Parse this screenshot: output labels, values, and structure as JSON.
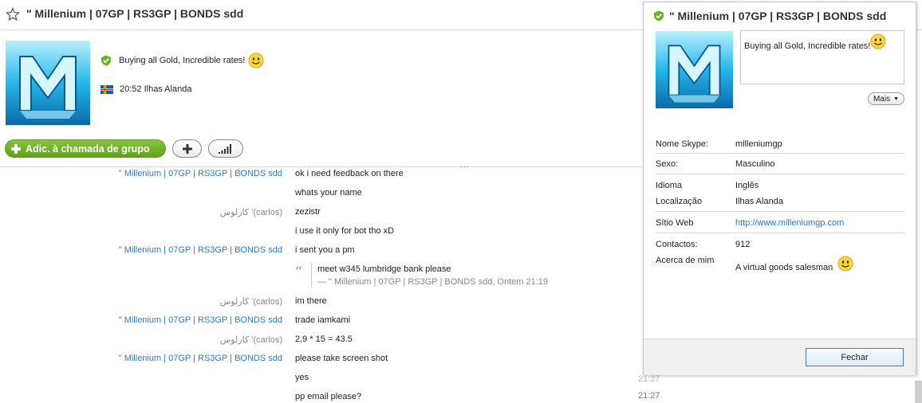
{
  "header": {
    "title": "\" Millenium | 07GP | RS3GP | BONDS sdd"
  },
  "profile": {
    "mood": "Buying all Gold, Incredible rates!",
    "time": "20:52",
    "location": "Ilhas Alanda"
  },
  "actions": {
    "call_label": "Adic. à chamada de grupo",
    "more_dots": "..."
  },
  "chat": {
    "messages": [
      {
        "sender": "\" Millenium | 07GP | RS3GP | BONDS sdd",
        "text": "ok i need feedback on there"
      },
      {
        "sender": "",
        "text": "whats your name"
      },
      {
        "sender": "کارلوس '(carlos)",
        "text": "zezistr"
      },
      {
        "sender": "",
        "text": "i use it only for bot tho xD"
      },
      {
        "sender": "\" Millenium | 07GP | RS3GP | BONDS sdd",
        "text": "i sent you a pm"
      },
      {
        "sender": "کارلوس '(carlos)",
        "text": "im there"
      },
      {
        "sender": "\" Millenium | 07GP | RS3GP | BONDS sdd",
        "text": "trade iamkami"
      },
      {
        "sender": "کارلوس '(carlos)",
        "text": "2,9 * 15 = 43.5"
      },
      {
        "sender": "\" Millenium | 07GP | RS3GP | BONDS sdd",
        "text": "please take screen shot"
      },
      {
        "sender": "",
        "text": "yes"
      },
      {
        "sender": "",
        "text": "pp email please?"
      }
    ],
    "quote": {
      "text": "meet w345 lumbridge bank please",
      "source": "— \" Millenium | 07GP | RS3GP | BONDS sdd, Ontem 21:19"
    },
    "timestamp_faded": "21:27",
    "timestamp_last": "21:27"
  },
  "dialog": {
    "title": "\" Millenium | 07GP | RS3GP | BONDS sdd",
    "mood": "Buying all Gold, Incredible rates!",
    "more_label": "Mais",
    "fields": {
      "skype_name_label": "Nome Skype:",
      "skype_name": "milleniumgp",
      "sex_label": "Sexo:",
      "sex": "Masculino",
      "language_label": "Idioma",
      "language": "Inglês",
      "location_label": "Localização",
      "location": "Ilhas Alanda",
      "website_label": "Sítio Web",
      "website": "http://www.milleniumgp.com",
      "contacts_label": "Contactos:",
      "contacts": "912",
      "about_label": "Acerca de mim",
      "about": "A virtual goods salesman"
    },
    "close_label": "Fechar"
  },
  "colors": {
    "accent_green": "#6cb222",
    "link_blue": "#2b7bc6"
  }
}
